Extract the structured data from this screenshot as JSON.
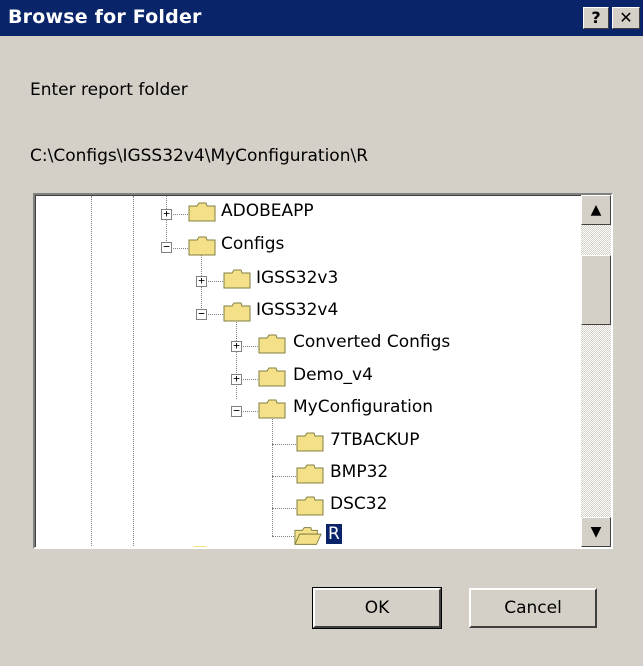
{
  "window": {
    "title": "Browse for Folder",
    "help_label": "?",
    "close_label": "✕"
  },
  "prompt": "Enter report folder",
  "path": "C:\\Configs\\IGSS32v4\\MyConfiguration\\R",
  "tree": {
    "items": [
      {
        "label": "ADOBEAPP",
        "expander": "+"
      },
      {
        "label": "Configs",
        "expander": "−"
      },
      {
        "label": "IGSS32v3",
        "expander": "+"
      },
      {
        "label": "IGSS32v4",
        "expander": "−"
      },
      {
        "label": "Converted Configs",
        "expander": "+"
      },
      {
        "label": "Demo_v4",
        "expander": "+"
      },
      {
        "label": "MyConfiguration",
        "expander": "−"
      },
      {
        "label": "7TBACKUP",
        "expander": ""
      },
      {
        "label": "BMP32",
        "expander": ""
      },
      {
        "label": "DSC32",
        "expander": ""
      },
      {
        "label": "R",
        "expander": "",
        "selected": true
      }
    ],
    "scroll_up": "▲",
    "scroll_down": "▼"
  },
  "buttons": {
    "ok": "OK",
    "cancel": "Cancel"
  },
  "colors": {
    "titlebar": "#0a246a",
    "face": "#d4d0c8",
    "folder": "#f5e08a",
    "selection": "#0a246a"
  }
}
